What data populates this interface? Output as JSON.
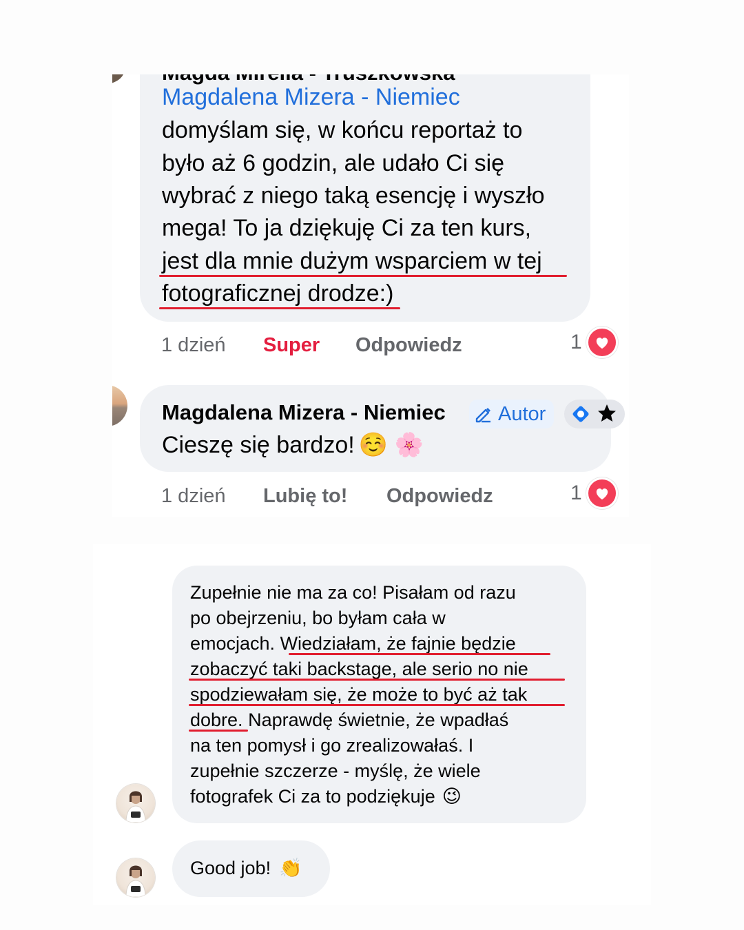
{
  "comment1": {
    "author_partial": "Magda Mirella - Truszkowska",
    "mention": "Magdalena Mizera - Niemiec",
    "lines": [
      "domyślam się, w końcu reportaż to",
      "było aż 6 godzin, ale udało Ci się",
      "wybrać z niego taką esencję i wyszło",
      "mega! To ja dziękuję Ci za ten kurs,",
      "jest dla mnie dużym wsparciem w tej",
      "fotograficznej drodze:)"
    ],
    "time": "1 dzień",
    "reaction_label": "Super",
    "reply_label": "Odpowiedz",
    "reaction_count": "1"
  },
  "comment2": {
    "author": "Magdalena Mizera - Niemiec",
    "author_badge": "Autor",
    "text": "Cieszę się bardzo!",
    "emojis": "☺️ 🌸",
    "time": "1 dzień",
    "like_label": "Lubię to!",
    "reply_label": "Odpowiedz",
    "reaction_count": "1"
  },
  "message1": {
    "lines": [
      "Zupełnie nie ma za co! Pisałam od razu",
      "po obejrzeniu, bo byłam cała w",
      "emocjach. ",
      "Wiedziałam, że fajnie będzie",
      "zobaczyć taki backstage, ale serio no nie",
      "spodziewałam się, że może to być aż tak",
      "dobre.",
      " Naprawdę świetnie, że wpadłaś",
      "na ten pomysł i go zrealizowałaś. I",
      "zupełnie szczerze - myślę, że wiele",
      "fotografek Ci za to podziękuje"
    ],
    "emoji": "😉"
  },
  "message2": {
    "text": "Good job!",
    "emoji": "👏"
  },
  "colors": {
    "bubble": "#f0f2f5",
    "mention": "#216fdb",
    "super": "#e41e3f",
    "meta": "#65676b",
    "underline": "#e11d2e",
    "heart": "#f33e58"
  }
}
